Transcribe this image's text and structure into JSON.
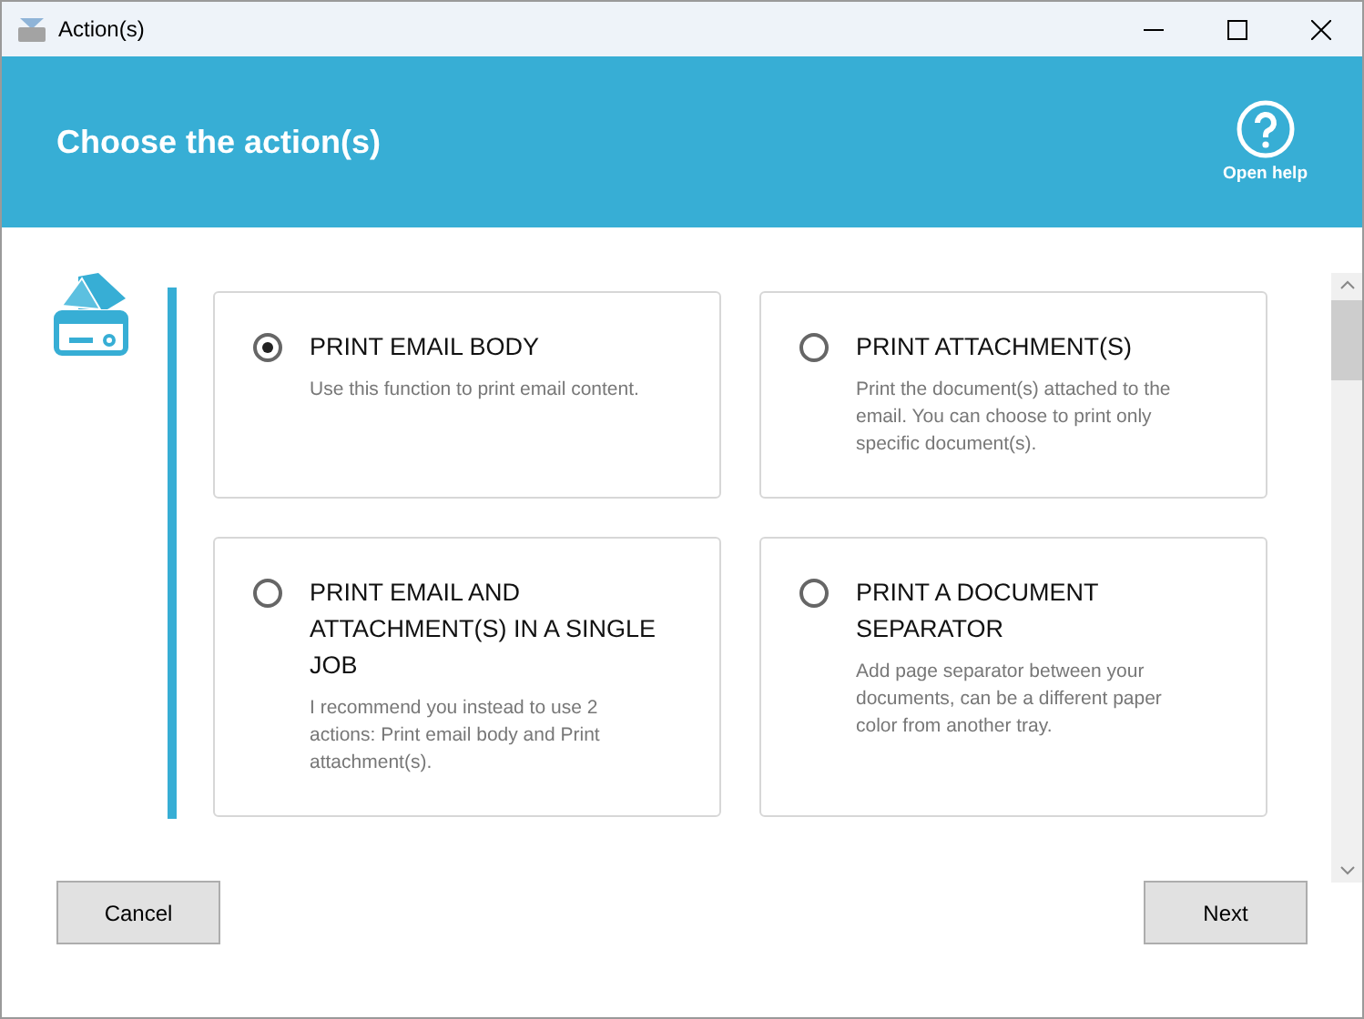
{
  "window": {
    "title": "Action(s)"
  },
  "header": {
    "title": "Choose the action(s)",
    "help_label": "Open help"
  },
  "actions": [
    {
      "title": "PRINT EMAIL BODY",
      "description": "Use this function to print email content.",
      "selected": true
    },
    {
      "title": "PRINT ATTACHMENT(S)",
      "description": "Print the document(s) attached to the email. You can choose to print only specific document(s).",
      "selected": false
    },
    {
      "title": "PRINT EMAIL AND ATTACHMENT(S) IN A SINGLE JOB",
      "description": "I recommend you instead to use 2 actions: Print email body and Print attachment(s).",
      "selected": false
    },
    {
      "title": "PRINT A DOCUMENT SEPARATOR",
      "description": "Add page separator between your documents, can be a different paper color from another tray.",
      "selected": false
    }
  ],
  "buttons": {
    "cancel": "Cancel",
    "next": "Next"
  }
}
